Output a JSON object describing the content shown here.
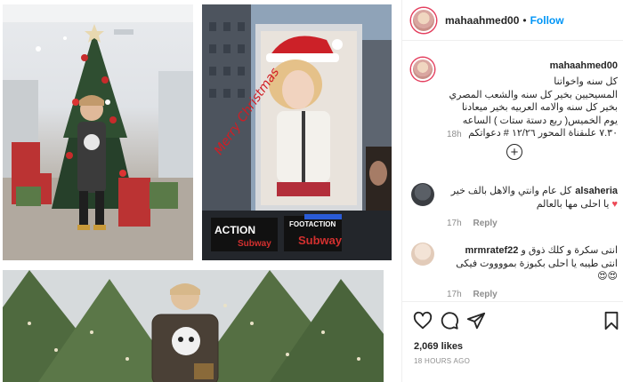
{
  "post": {
    "author": "mahaahmed00",
    "follow_label": "Follow",
    "separator": "•"
  },
  "caption": {
    "username": "mahaahmed00",
    "lines": [
      "كل سنه واخواتنا",
      "المسيحيين بخير كل سنه والشعب المصري",
      "بخير كل سنه والامه العربيه بخير ميعادنا",
      "يوم الخميس( ربع دستة ستات ) الساعه",
      "٧.٣٠ علىقناة المحور ١٢/٢٦ # دعواتكم"
    ],
    "time": "18h"
  },
  "comments": [
    {
      "username": "alsaheria",
      "text": "كل عام وانتي والاهل بالف خير",
      "text2": "يا احلى مها بالعالم",
      "emoji": "♥",
      "time": "17h",
      "reply_label": "Reply"
    },
    {
      "username": "mrmratef22",
      "text": "انتى سكرة و كلك ذوق و",
      "text2": "انتى طيبه يا احلى بكبوزة بمووووت فيكى",
      "text3": "😍😍",
      "time": "17h",
      "reply_label": "Reply"
    }
  ],
  "media_overlay": {
    "billboard_text": "Merry Christmas",
    "sign_action": "ACTION",
    "sign_subway": "Subway",
    "sign_subway_2": "Subway",
    "sign_footaction": "FOOTACTION"
  },
  "engagement": {
    "likes": "2,069 likes",
    "posted": "18 HOURS AGO"
  },
  "icons": {
    "like": "heart-icon",
    "comment": "comment-icon",
    "share": "paper-plane-icon",
    "save": "bookmark-icon",
    "load_more": "plus-circle-icon"
  },
  "colors": {
    "link": "#0095f6",
    "text": "#262626",
    "muted": "#8e8e8e",
    "story_ring": "#e4405f",
    "heart": "#ed4956"
  }
}
